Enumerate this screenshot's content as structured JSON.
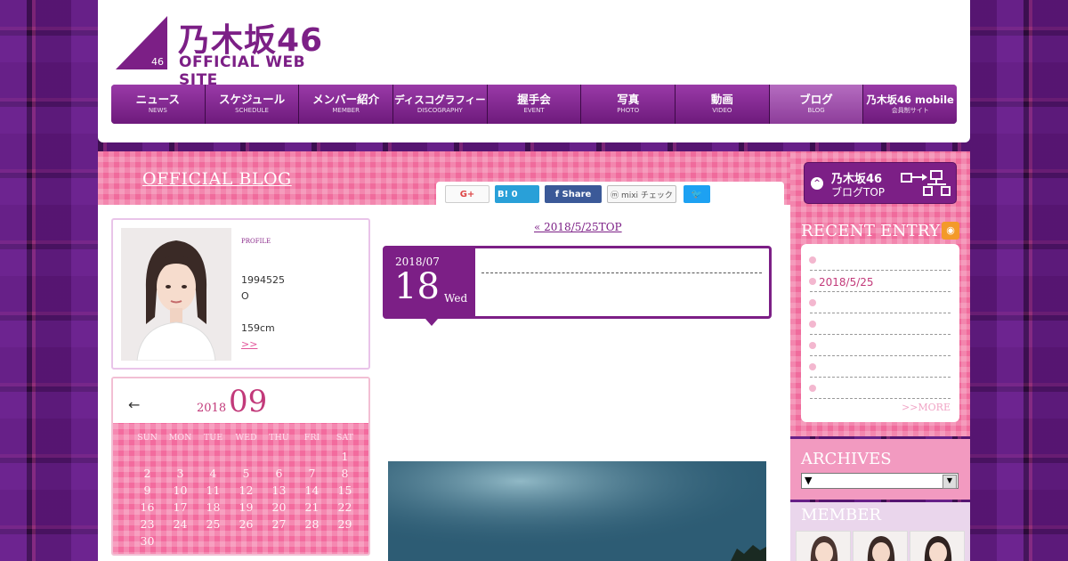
{
  "header": {
    "logo_jp": "乃木坂46",
    "logo_en": "OFFICIAL WEB SITE",
    "logo_mark": "46",
    "brand_color": "#7c1f86"
  },
  "nav": [
    {
      "jp": "ニュース",
      "en": "NEWS"
    },
    {
      "jp": "スケジュール",
      "en": "SCHEDULE"
    },
    {
      "jp": "メンバー紹介",
      "en": "MEMBER"
    },
    {
      "jp": "ディスコグラフィー",
      "en": "DISCOGRAPHY"
    },
    {
      "jp": "握手会",
      "en": "EVENT"
    },
    {
      "jp": "写真",
      "en": "PHOTO"
    },
    {
      "jp": "動画",
      "en": "VIDEO"
    },
    {
      "jp": "ブログ",
      "en": "BLOG"
    },
    {
      "jp": "乃木坂46 mobile",
      "en": "会員制サイト"
    }
  ],
  "blog": {
    "title": "OFFICIAL BLOG"
  },
  "social": {
    "google": "G+",
    "hatena": "B! 0",
    "facebook": "f  Share",
    "mixi": "ⓜ mixi チェック",
    "twitter": "🐦"
  },
  "profile": {
    "label": "PROFILE",
    "birthday": "1994525",
    "blood": "O",
    "height": "159cm",
    "more": ">>"
  },
  "calendar": {
    "prev": "←",
    "year": "2018",
    "month": "09",
    "dow": [
      "SUN",
      "MON",
      "TUE",
      "WED",
      "THU",
      "FRI",
      "SAT"
    ],
    "weeks": [
      [
        "",
        "",
        "",
        "",
        "",
        "",
        "1"
      ],
      [
        "2",
        "3",
        "4",
        "5",
        "6",
        "7",
        "8"
      ],
      [
        "9",
        "10",
        "11",
        "12",
        "13",
        "14",
        "15"
      ],
      [
        "16",
        "17",
        "18",
        "19",
        "20",
        "21",
        "22"
      ],
      [
        "23",
        "24",
        "25",
        "26",
        "27",
        "28",
        "29"
      ],
      [
        "30",
        "",
        "",
        "",
        "",
        "",
        ""
      ]
    ]
  },
  "post": {
    "nav": "« 2018/5/25TOP",
    "year_month": "2018/07",
    "day": "18",
    "weekday": "Wed"
  },
  "sidebar": {
    "blogtop_line1": "乃木坂46",
    "blogtop_line2": "ブログTOP",
    "recent_title": "RECENT ENTRY",
    "recent": [
      "",
      "2018/5/25",
      "",
      "",
      "",
      "",
      ""
    ],
    "more": ">>MORE",
    "archives_title": "ARCHIVES",
    "archives_value": "▼",
    "member_title": "MEMBER"
  }
}
